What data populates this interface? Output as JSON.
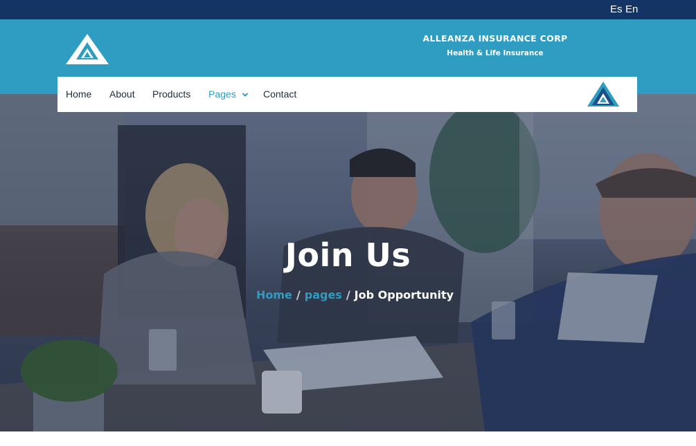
{
  "topbar": {
    "languages": [
      "Es",
      "En"
    ]
  },
  "header": {
    "brand_name": "ALLEANZA INSURANCE CORP",
    "brand_tagline": "Health & Life Insurance"
  },
  "nav": {
    "items": [
      "Home",
      "About",
      "Products",
      "Pages",
      "Contact"
    ],
    "active_item": "Pages"
  },
  "hero": {
    "title": "Join Us",
    "breadcrumb": {
      "home": "Home",
      "section": "pages",
      "current": "Job Opportunity",
      "separator": "/"
    }
  },
  "colors": {
    "topbar": "#143466",
    "header": "#2f9cc1",
    "accent": "#2f9cc1",
    "nav_text": "#1c2b3f"
  },
  "icons": {
    "logo": "triangle-logo-icon",
    "pages_dropdown": "chevron-down-icon"
  }
}
